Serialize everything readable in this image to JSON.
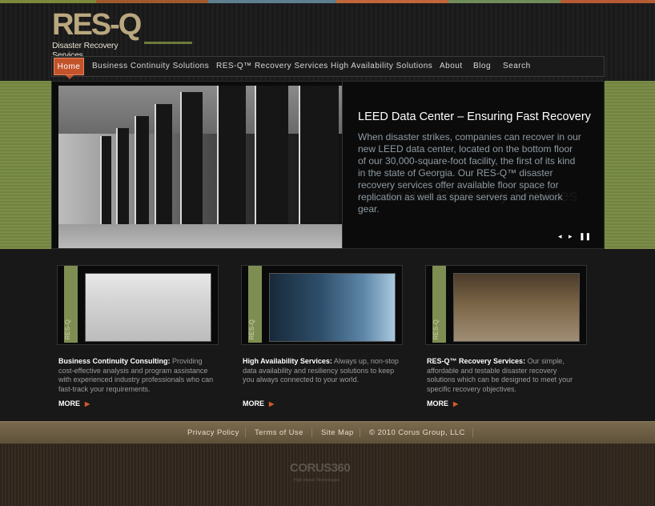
{
  "logo": {
    "mark": "RES-Q",
    "tagline": "Disaster Recovery Services"
  },
  "nav": {
    "items": [
      {
        "label": "Home"
      },
      {
        "label": "Business Continuity Solutions"
      },
      {
        "label": "RES-Q™ Recovery Services"
      },
      {
        "label": "High Availability Solutions"
      },
      {
        "label": "About"
      },
      {
        "label": "Blog"
      },
      {
        "label": "Search"
      }
    ]
  },
  "slide": {
    "title": "LEED Data Center – Ensuring Fast Recovery",
    "text": "When disaster strikes, companies can recover in our new LEED data center, located on the bottom floor of our 30,000-square-foot facility, the first of its kind in the state of Georgia. Our RES-Q™ disaster recovery services offer available floor space for replication as well as spare servers and network gear.",
    "watermark": "Disaster Recovery Services",
    "controls": {
      "prev": "◂",
      "next": "▸",
      "pause": "❚❚"
    }
  },
  "cards": [
    {
      "tab_logo": "RES-Q",
      "title": "Business Continuity Consulting:",
      "text": " Providing cost-effective analysis and program assistance with experienced industry professionals who can fast-track your requirements.",
      "more": "MORE"
    },
    {
      "tab_logo": "RES-Q",
      "title": "High Availability Services:",
      "text": " Always up, non-stop data availability and resiliency solutions to keep you always connected to your world.",
      "more": "MORE"
    },
    {
      "tab_logo": "RES-Q",
      "title": "RES-Q™ Recovery Services:",
      "text": " Our simple, affordable and testable disaster recovery solutions which can be designed to meet your specific recovery objectives.",
      "more": "MORE"
    }
  ],
  "footer": {
    "links": [
      "Privacy Policy",
      "Terms of Use",
      "Site Map"
    ],
    "copyright": "© 2010 Corus Group, LLC"
  },
  "brand": {
    "name": "CORUS360",
    "tagline": "High Impact Technologies"
  },
  "colors": {
    "accent": "#c3532b",
    "green": "#7c8d4a",
    "footer": "#6b5d44"
  }
}
